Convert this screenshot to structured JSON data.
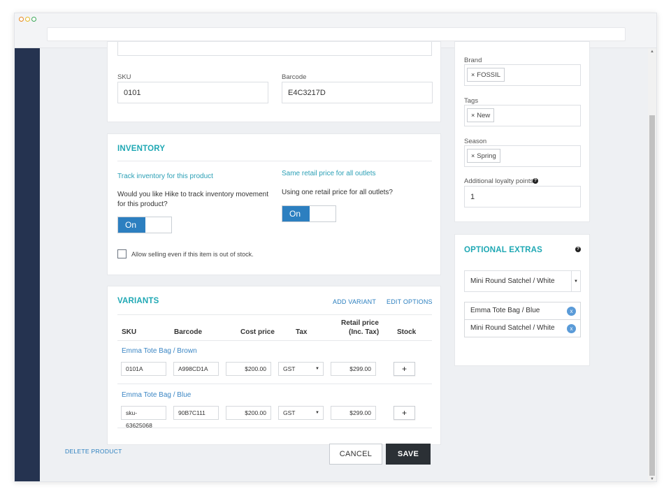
{
  "window": {
    "dot_colors": [
      "#e8871e",
      "#e5b827",
      "#3aa757"
    ]
  },
  "product": {
    "sku_label": "SKU",
    "sku_value": "0101",
    "barcode_label": "Barcode",
    "barcode_value": "E4C3217D"
  },
  "inventory": {
    "title": "INVENTORY",
    "track_title": "Track inventory for this product",
    "track_question": "Would you like Hike to track inventory movement for this product?",
    "track_toggle": "On",
    "retail_title": "Same retail price for all outlets",
    "retail_question": "Using one retail price for all outlets?",
    "retail_toggle": "On",
    "allow_selling": "Allow selling even if this item is out of stock."
  },
  "variants": {
    "title": "VARIANTS",
    "add_variant": "ADD VARIANT",
    "edit_options": "EDIT OPTIONS",
    "columns": {
      "sku": "SKU",
      "barcode": "Barcode",
      "cost": "Cost price",
      "tax": "Tax",
      "retail_line1": "Retail price",
      "retail_line2": "(Inc. Tax)",
      "stock": "Stock"
    },
    "rows": [
      {
        "name": "Emma Tote Bag / Brown",
        "sku": "0101A",
        "barcode": "A998CD1A",
        "cost": "$200.00",
        "tax": "GST",
        "retail": "$299.00",
        "stock_button": "+"
      },
      {
        "name": "Emma Tote Bag / Blue",
        "sku": "sku-63625068",
        "barcode": "90B7C111",
        "cost": "$200.00",
        "tax": "GST",
        "retail": "$299.00",
        "stock_button": "+"
      }
    ]
  },
  "actions": {
    "delete": "DELETE PRODUCT",
    "cancel": "CANCEL",
    "save": "SAVE"
  },
  "side": {
    "brand_label": "Brand",
    "brand_tag": "FOSSIL",
    "tags_label": "Tags",
    "tags_tag": "New",
    "season_label": "Season",
    "season_tag": "Spring",
    "loyalty_label": "Additional loyalty points",
    "loyalty_value": "1",
    "tag_remove_symbol": "×",
    "help_symbol": "?"
  },
  "extras": {
    "title": "OPTIONAL EXTRAS",
    "select_value": "Mini Round Satchel / White",
    "items": [
      "Emma Tote Bag / Blue",
      "Mini Round Satchel / White"
    ],
    "remove_symbol": "x"
  },
  "icons": {
    "caret": "▼",
    "scroll_up": "▲",
    "scroll_down": "▼"
  }
}
